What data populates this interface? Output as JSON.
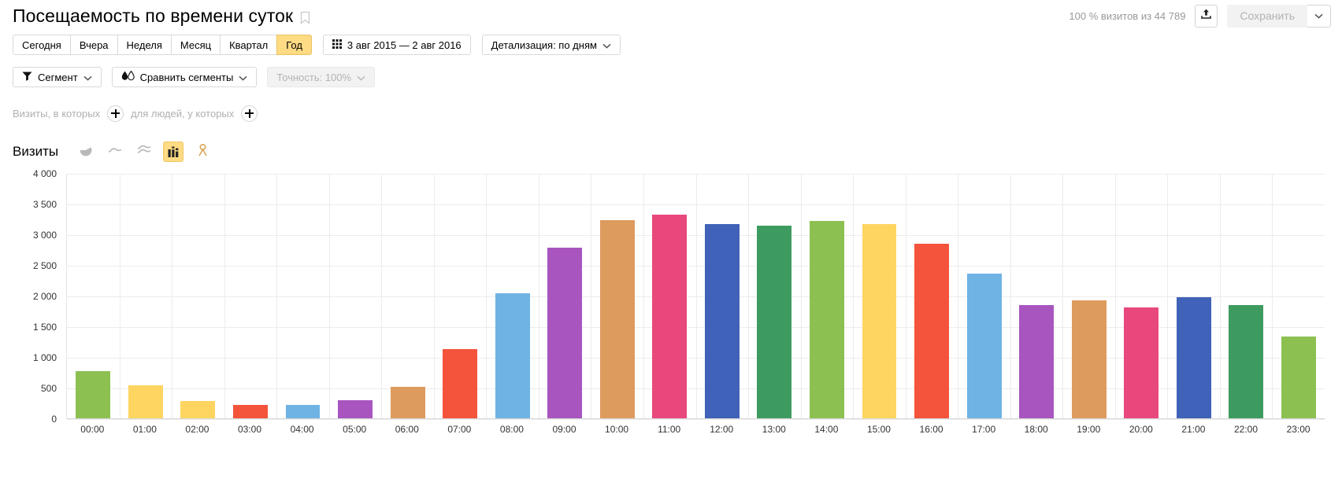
{
  "header": {
    "title": "Посещаемость по времени суток",
    "bookmark_icon": "bookmark-icon",
    "visits_note": "100 % визитов из 44 789",
    "export_icon": "export-upload-icon",
    "save_label": "Сохранить",
    "save_caret_icon": "chevron-down-icon"
  },
  "periods": {
    "items": [
      {
        "label": "Сегодня",
        "active": false
      },
      {
        "label": "Вчера",
        "active": false
      },
      {
        "label": "Неделя",
        "active": false
      },
      {
        "label": "Месяц",
        "active": false
      },
      {
        "label": "Квартал",
        "active": false
      },
      {
        "label": "Год",
        "active": true
      }
    ],
    "date_range": "3 авг 2015 — 2 авг 2016",
    "calendar_icon": "calendar-grid-icon",
    "detail_label": "Детализация: по дням",
    "detail_caret_icon": "chevron-down-icon"
  },
  "segments": {
    "segment_label": "Сегмент",
    "segment_icon": "funnel-filter-icon",
    "compare_label": "Сравнить сегменты",
    "compare_icon": "two-droplets-icon",
    "accuracy_label": "Точность: 100%",
    "caret_icon": "chevron-down-icon"
  },
  "filters": {
    "visits_label": "Визиты, в которых",
    "people_label": "для людей, у которых",
    "add_icon": "plus-circle-icon"
  },
  "metric": {
    "name": "Визиты",
    "chart_types": [
      {
        "name": "pie-chart-icon",
        "active": false
      },
      {
        "name": "line-chart-icon",
        "active": false
      },
      {
        "name": "area-chart-icon",
        "active": false
      },
      {
        "name": "bar-chart-icon",
        "active": true
      },
      {
        "name": "map-person-icon",
        "active": false
      }
    ]
  },
  "chart_data": {
    "type": "bar",
    "title": "Посещаемость по времени суток",
    "xlabel": "",
    "ylabel": "Визиты",
    "ylim": [
      0,
      4000
    ],
    "ytick_labels": [
      "0",
      "500",
      "1 000",
      "1 500",
      "2 000",
      "2 500",
      "3 000",
      "3 500",
      "4 000"
    ],
    "yticks": [
      0,
      500,
      1000,
      1500,
      2000,
      2500,
      3000,
      3500,
      4000
    ],
    "grid": true,
    "legend": "none",
    "categories": [
      "00:00",
      "01:00",
      "02:00",
      "03:00",
      "04:00",
      "05:00",
      "06:00",
      "07:00",
      "08:00",
      "09:00",
      "10:00",
      "11:00",
      "12:00",
      "13:00",
      "14:00",
      "15:00",
      "16:00",
      "17:00",
      "18:00",
      "19:00",
      "20:00",
      "21:00",
      "22:00",
      "23:00"
    ],
    "values": [
      780,
      550,
      300,
      230,
      230,
      305,
      520,
      1145,
      2050,
      2790,
      3250,
      3330,
      3180,
      3150,
      3230,
      3180,
      2860,
      2370,
      1865,
      1940,
      1825,
      1990,
      1860,
      1345
    ],
    "colors": [
      "#8CC152",
      "#FFD561",
      "#FFD561",
      "#F4543C",
      "#6FB2E4",
      "#A855C0",
      "#DD9B5E",
      "#F4543C",
      "#6FB2E4",
      "#A855C0",
      "#DD9B5E",
      "#E8487B",
      "#4062B8",
      "#3E9B5F",
      "#8CC152",
      "#FFD561",
      "#F4543C",
      "#6FB2E4",
      "#A855C0",
      "#DD9B5E",
      "#E8487B",
      "#4062B8",
      "#3E9B5F",
      "#8CC152"
    ],
    "accent_color": "#ffdb83",
    "grid_color": "#ececec"
  }
}
